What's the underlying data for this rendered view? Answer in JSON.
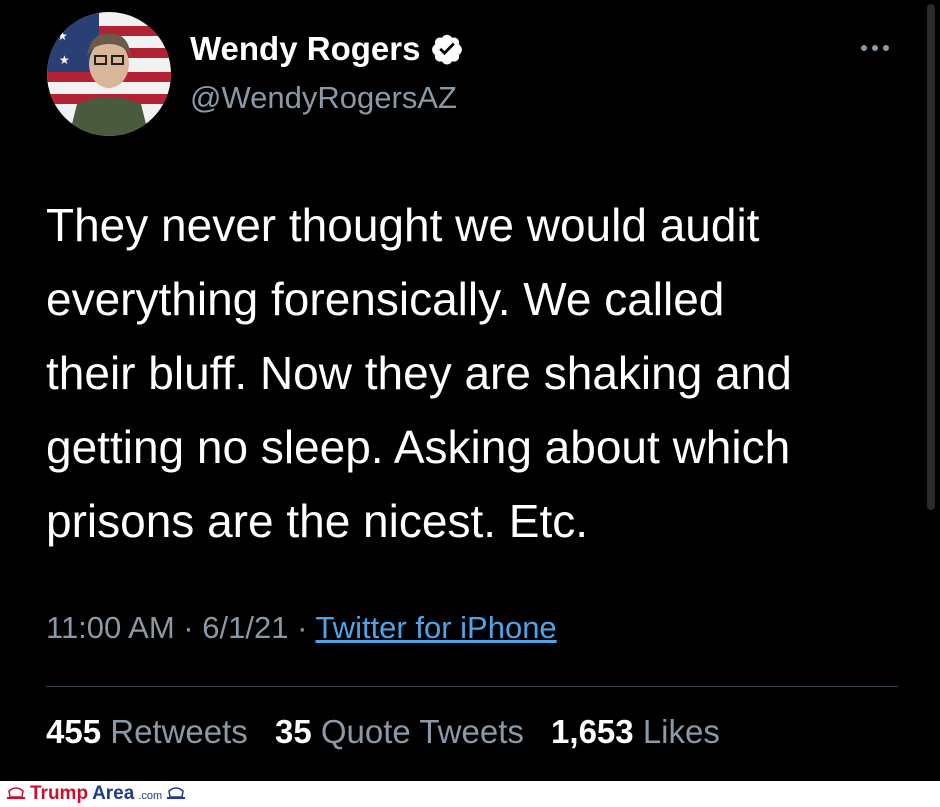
{
  "tweet": {
    "display_name": "Wendy Rogers",
    "handle": "@WendyRogersAZ",
    "text": "They never thought we would audit\neverything forensically. We called\ntheir bluff. Now they are shaking and\ngetting no sleep. Asking about which\nprisons are the nicest. Etc.",
    "time": "11:00 AM",
    "date": "6/1/21",
    "sep": " · ",
    "source": "Twitter for iPhone",
    "stats": {
      "retweets_count": "455",
      "retweets_label": "Retweets",
      "quotes_count": "35",
      "quotes_label": "Quote Tweets",
      "likes_count": "1,653",
      "likes_label": "Likes"
    }
  },
  "icons": {
    "verified": "verified-badge-icon",
    "more": "more-options-icon"
  },
  "footer": {
    "brand_part1": "Trump",
    "brand_part2": "Area",
    "brand_domain": ".com"
  },
  "colors": {
    "background": "#000000",
    "muted_text": "#8b98a5",
    "link": "#4ea4e6",
    "brand_red": "#c8102e",
    "brand_blue": "#1f3b8a"
  }
}
